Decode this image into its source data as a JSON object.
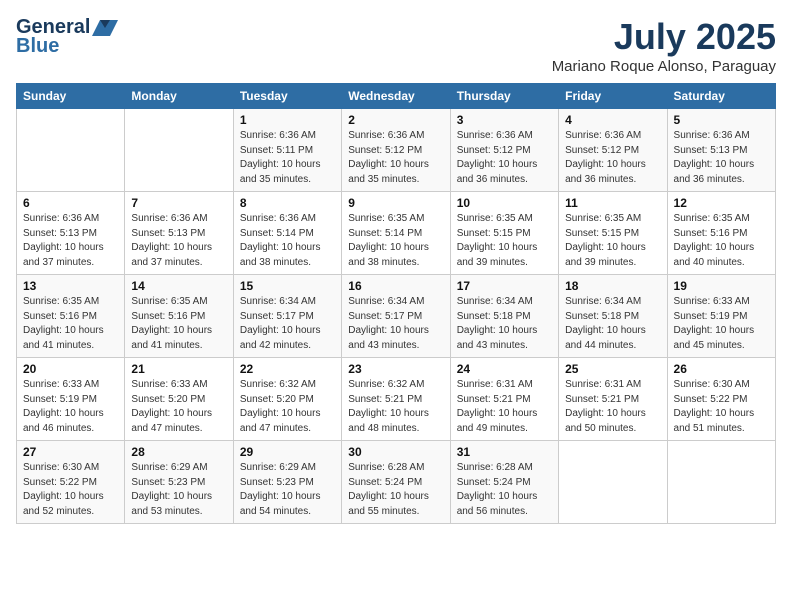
{
  "header": {
    "logo_general": "General",
    "logo_blue": "Blue",
    "month": "July 2025",
    "location": "Mariano Roque Alonso, Paraguay"
  },
  "columns": [
    "Sunday",
    "Monday",
    "Tuesday",
    "Wednesday",
    "Thursday",
    "Friday",
    "Saturday"
  ],
  "weeks": [
    [
      {
        "day": "",
        "detail": ""
      },
      {
        "day": "",
        "detail": ""
      },
      {
        "day": "1",
        "detail": "Sunrise: 6:36 AM\nSunset: 5:11 PM\nDaylight: 10 hours\nand 35 minutes."
      },
      {
        "day": "2",
        "detail": "Sunrise: 6:36 AM\nSunset: 5:12 PM\nDaylight: 10 hours\nand 35 minutes."
      },
      {
        "day": "3",
        "detail": "Sunrise: 6:36 AM\nSunset: 5:12 PM\nDaylight: 10 hours\nand 36 minutes."
      },
      {
        "day": "4",
        "detail": "Sunrise: 6:36 AM\nSunset: 5:12 PM\nDaylight: 10 hours\nand 36 minutes."
      },
      {
        "day": "5",
        "detail": "Sunrise: 6:36 AM\nSunset: 5:13 PM\nDaylight: 10 hours\nand 36 minutes."
      }
    ],
    [
      {
        "day": "6",
        "detail": "Sunrise: 6:36 AM\nSunset: 5:13 PM\nDaylight: 10 hours\nand 37 minutes."
      },
      {
        "day": "7",
        "detail": "Sunrise: 6:36 AM\nSunset: 5:13 PM\nDaylight: 10 hours\nand 37 minutes."
      },
      {
        "day": "8",
        "detail": "Sunrise: 6:36 AM\nSunset: 5:14 PM\nDaylight: 10 hours\nand 38 minutes."
      },
      {
        "day": "9",
        "detail": "Sunrise: 6:35 AM\nSunset: 5:14 PM\nDaylight: 10 hours\nand 38 minutes."
      },
      {
        "day": "10",
        "detail": "Sunrise: 6:35 AM\nSunset: 5:15 PM\nDaylight: 10 hours\nand 39 minutes."
      },
      {
        "day": "11",
        "detail": "Sunrise: 6:35 AM\nSunset: 5:15 PM\nDaylight: 10 hours\nand 39 minutes."
      },
      {
        "day": "12",
        "detail": "Sunrise: 6:35 AM\nSunset: 5:16 PM\nDaylight: 10 hours\nand 40 minutes."
      }
    ],
    [
      {
        "day": "13",
        "detail": "Sunrise: 6:35 AM\nSunset: 5:16 PM\nDaylight: 10 hours\nand 41 minutes."
      },
      {
        "day": "14",
        "detail": "Sunrise: 6:35 AM\nSunset: 5:16 PM\nDaylight: 10 hours\nand 41 minutes."
      },
      {
        "day": "15",
        "detail": "Sunrise: 6:34 AM\nSunset: 5:17 PM\nDaylight: 10 hours\nand 42 minutes."
      },
      {
        "day": "16",
        "detail": "Sunrise: 6:34 AM\nSunset: 5:17 PM\nDaylight: 10 hours\nand 43 minutes."
      },
      {
        "day": "17",
        "detail": "Sunrise: 6:34 AM\nSunset: 5:18 PM\nDaylight: 10 hours\nand 43 minutes."
      },
      {
        "day": "18",
        "detail": "Sunrise: 6:34 AM\nSunset: 5:18 PM\nDaylight: 10 hours\nand 44 minutes."
      },
      {
        "day": "19",
        "detail": "Sunrise: 6:33 AM\nSunset: 5:19 PM\nDaylight: 10 hours\nand 45 minutes."
      }
    ],
    [
      {
        "day": "20",
        "detail": "Sunrise: 6:33 AM\nSunset: 5:19 PM\nDaylight: 10 hours\nand 46 minutes."
      },
      {
        "day": "21",
        "detail": "Sunrise: 6:33 AM\nSunset: 5:20 PM\nDaylight: 10 hours\nand 47 minutes."
      },
      {
        "day": "22",
        "detail": "Sunrise: 6:32 AM\nSunset: 5:20 PM\nDaylight: 10 hours\nand 47 minutes."
      },
      {
        "day": "23",
        "detail": "Sunrise: 6:32 AM\nSunset: 5:21 PM\nDaylight: 10 hours\nand 48 minutes."
      },
      {
        "day": "24",
        "detail": "Sunrise: 6:31 AM\nSunset: 5:21 PM\nDaylight: 10 hours\nand 49 minutes."
      },
      {
        "day": "25",
        "detail": "Sunrise: 6:31 AM\nSunset: 5:21 PM\nDaylight: 10 hours\nand 50 minutes."
      },
      {
        "day": "26",
        "detail": "Sunrise: 6:30 AM\nSunset: 5:22 PM\nDaylight: 10 hours\nand 51 minutes."
      }
    ],
    [
      {
        "day": "27",
        "detail": "Sunrise: 6:30 AM\nSunset: 5:22 PM\nDaylight: 10 hours\nand 52 minutes."
      },
      {
        "day": "28",
        "detail": "Sunrise: 6:29 AM\nSunset: 5:23 PM\nDaylight: 10 hours\nand 53 minutes."
      },
      {
        "day": "29",
        "detail": "Sunrise: 6:29 AM\nSunset: 5:23 PM\nDaylight: 10 hours\nand 54 minutes."
      },
      {
        "day": "30",
        "detail": "Sunrise: 6:28 AM\nSunset: 5:24 PM\nDaylight: 10 hours\nand 55 minutes."
      },
      {
        "day": "31",
        "detail": "Sunrise: 6:28 AM\nSunset: 5:24 PM\nDaylight: 10 hours\nand 56 minutes."
      },
      {
        "day": "",
        "detail": ""
      },
      {
        "day": "",
        "detail": ""
      }
    ]
  ]
}
